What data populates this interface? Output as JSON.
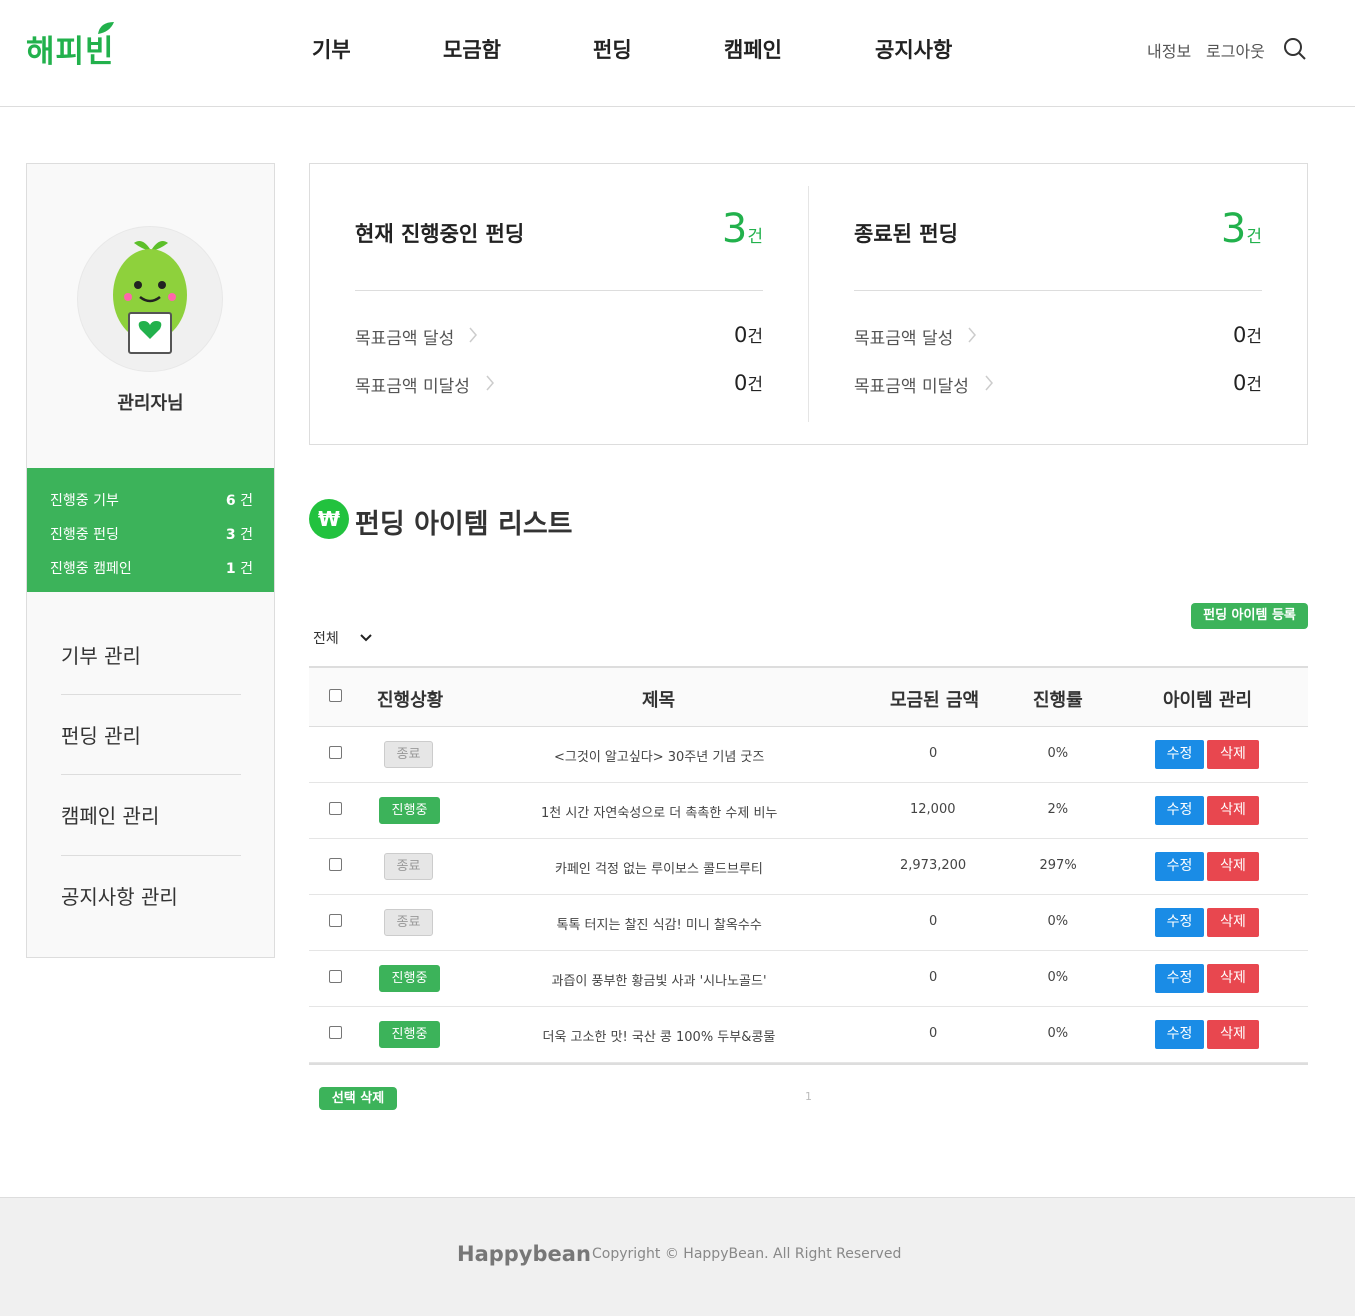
{
  "header": {
    "logo": "해피빈",
    "nav": [
      "기부",
      "모금함",
      "펀딩",
      "캠페인",
      "공지사항"
    ],
    "my_info": "내정보",
    "logout": "로그아웃",
    "search_icon": "search-icon"
  },
  "sidebar": {
    "username": "관리자님",
    "status": [
      {
        "label": "진행중 기부",
        "count": "6",
        "unit": "건"
      },
      {
        "label": "진행중 펀딩",
        "count": "3",
        "unit": "건"
      },
      {
        "label": "진행중 캠페인",
        "count": "1",
        "unit": "건"
      }
    ],
    "menu": [
      "기부 관리",
      "펀딩 관리",
      "캠페인 관리",
      "공지사항 관리"
    ]
  },
  "summary": {
    "ongoing": {
      "title": "현재 진행중인 펀딩",
      "count": "3",
      "unit": "건",
      "rows": [
        {
          "label": "목표금액 달성",
          "value": "0",
          "unit": "건"
        },
        {
          "label": "목표금액 미달성",
          "value": "0",
          "unit": "건"
        }
      ]
    },
    "ended": {
      "title": "종료된 펀딩",
      "count": "3",
      "unit": "건",
      "rows": [
        {
          "label": "목표금액 달성",
          "value": "0",
          "unit": "건"
        },
        {
          "label": "목표금액 미달성",
          "value": "0",
          "unit": "건"
        }
      ]
    }
  },
  "section": {
    "icon": "₩",
    "title": "펀딩 아이템 리스트",
    "register_button": "펀딩 아이템 등록",
    "filter_value": "전체"
  },
  "table": {
    "headers": [
      "진행상황",
      "제목",
      "모금된 금액",
      "진행률",
      "아이템 관리"
    ],
    "edit_label": "수정",
    "delete_label": "삭제",
    "rows": [
      {
        "status": "종료",
        "status_type": "end",
        "title": "<그것이 알고싶다> 30주년 기념 굿즈",
        "amount": "0",
        "rate": "0%"
      },
      {
        "status": "진행중",
        "status_type": "ing",
        "title": "1천 시간 자연숙성으로 더 촉촉한 수제 비누",
        "amount": "12,000",
        "rate": "2%"
      },
      {
        "status": "종료",
        "status_type": "end",
        "title": "카페인 걱정 없는 루이보스 콜드브루티",
        "amount": "2,973,200",
        "rate": "297%"
      },
      {
        "status": "종료",
        "status_type": "end",
        "title": "톡톡 터지는 찰진 식감! 미니 찰옥수수",
        "amount": "0",
        "rate": "0%"
      },
      {
        "status": "진행중",
        "status_type": "ing",
        "title": "과즙이 풍부한 황금빛 사과 '시나노골드'",
        "amount": "0",
        "rate": "0%"
      },
      {
        "status": "진행중",
        "status_type": "ing",
        "title": "더욱 고소한 맛! 국산 콩 100% 두부&콩물",
        "amount": "0",
        "rate": "0%"
      }
    ]
  },
  "bottom": {
    "delete_selected": "선택 삭제",
    "page": "1"
  },
  "footer": {
    "logo": "Happybean",
    "copyright": "Copyright © HappyBean. All Right Reserved"
  },
  "colors": {
    "brand_green": "#22b14c",
    "sidebar_green": "#3cb35a",
    "edit_blue": "#1a8ce6",
    "delete_red": "#e8474f"
  }
}
